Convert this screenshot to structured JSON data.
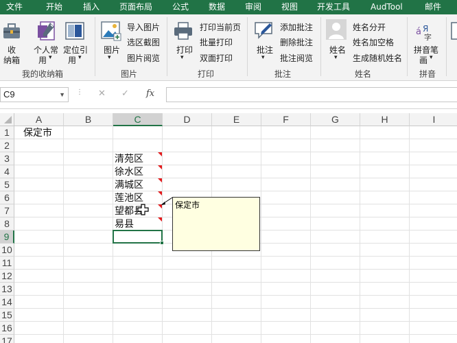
{
  "menu": [
    "文件",
    "开始",
    "插入",
    "页面布局",
    "公式",
    "数据",
    "审阅",
    "视图",
    "开发工具",
    "AudTool",
    "邮件"
  ],
  "ribbon": {
    "collect_group": {
      "label": "我的收纳箱",
      "collect_label_1": "收",
      "collect_label_2": "纳箱",
      "personal_label_1": "个人常",
      "personal_label_2": "用",
      "locate_label_1": "定位引",
      "locate_label_2": "用"
    },
    "picture_group": {
      "label": "图片",
      "picture_label": "图片",
      "import": "导入图片",
      "select_capture": "选区截图",
      "browse": "图片阅览"
    },
    "print_group": {
      "label": "打印",
      "print_label": "打印",
      "print_current": "打印当前页",
      "batch_print": "批量打印",
      "duplex_print": "双面打印"
    },
    "annotate_group": {
      "label": "批注",
      "annotate_label": "批注",
      "add": "添加批注",
      "delete": "删除批注",
      "browse": "批注阅览"
    },
    "name_group": {
      "label": "姓名",
      "name_label": "姓名",
      "split": "姓名分开",
      "add_space": "姓名加空格",
      "random": "生成随机姓名"
    },
    "pinyin_group": {
      "label": "拼音",
      "pinyin_label_1": "拼音笔",
      "pinyin_label_2": "画"
    }
  },
  "formula_bar": {
    "name_box": "C9",
    "cancel": "✕",
    "enter": "✓",
    "fx": "fx",
    "formula": ""
  },
  "sheet": {
    "columns": [
      "A",
      "B",
      "C",
      "D",
      "E",
      "F",
      "G",
      "H",
      "I"
    ],
    "rows": [
      "1",
      "2",
      "3",
      "4",
      "5",
      "6",
      "7",
      "8",
      "9",
      "10",
      "11",
      "12",
      "13",
      "14",
      "15",
      "16",
      "17"
    ],
    "selected_column": "C",
    "selected_row": "9",
    "cells": {
      "A1": "保定市",
      "C3": "清苑区",
      "C4": "徐水区",
      "C5": "满城区",
      "C6": "莲池区",
      "C7": "望都县",
      "C8": "易县"
    },
    "comment_text": "保定市"
  },
  "colors": {
    "accent": "#217346",
    "comment_indicator": "#e31a1c",
    "comment_bg": "#ffffe1"
  }
}
